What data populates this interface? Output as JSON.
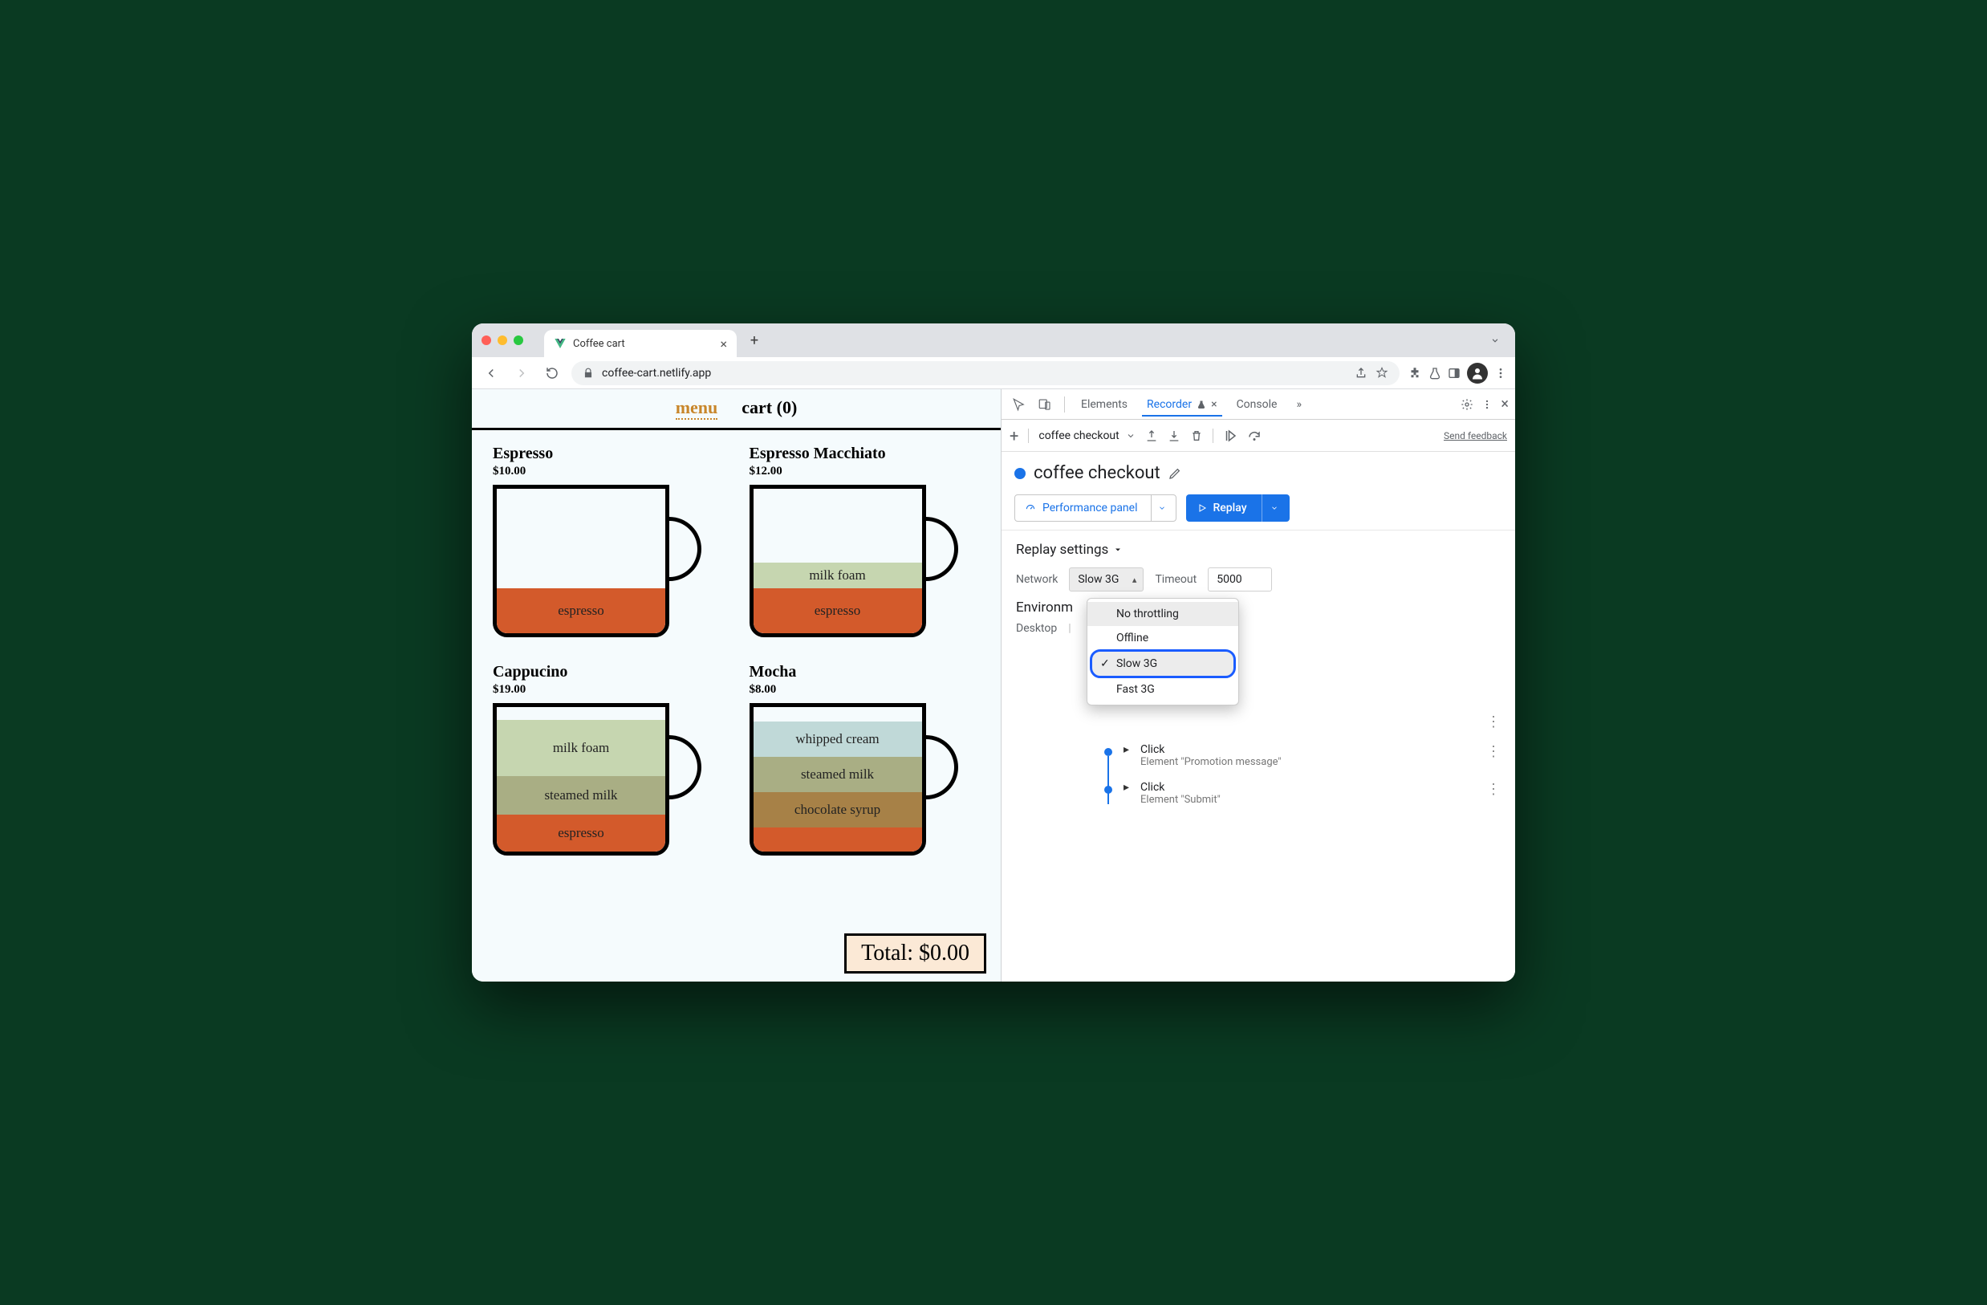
{
  "browser": {
    "tab_title": "Coffee cart",
    "url": "coffee-cart.netlify.app"
  },
  "page": {
    "nav": {
      "menu": "menu",
      "cart": "cart (0)"
    },
    "products": [
      {
        "name": "Espresso",
        "price": "$10.00",
        "layers": [
          "espresso"
        ]
      },
      {
        "name": "Espresso Macchiato",
        "price": "$12.00",
        "layers": [
          "milk foam",
          "espresso"
        ]
      },
      {
        "name": "Cappucino",
        "price": "$19.00",
        "layers": [
          "milk foam",
          "steamed milk",
          "espresso"
        ]
      },
      {
        "name": "Mocha",
        "price": "$8.00",
        "layers": [
          "whipped cream",
          "steamed milk",
          "chocolate syrup"
        ]
      }
    ],
    "total": "Total: $0.00"
  },
  "devtools": {
    "tabs": {
      "elements": "Elements",
      "recorder": "Recorder",
      "console": "Console",
      "more": "»"
    },
    "toolbar": {
      "recording_name": "coffee checkout",
      "send_feedback": "Send feedback"
    },
    "title": "coffee checkout",
    "actions": {
      "performance": "Performance panel",
      "replay": "Replay"
    },
    "replay_settings": {
      "heading": "Replay settings",
      "network_label": "Network",
      "network_value": "Slow 3G",
      "timeout_label": "Timeout",
      "timeout_value": "5000",
      "environment_label": "Environm",
      "desktop_label": "Desktop",
      "options": [
        "No throttling",
        "Offline",
        "Slow 3G",
        "Fast 3G"
      ]
    },
    "steps": [
      {
        "title": "Click",
        "sub": "Element \"Promotion message\""
      },
      {
        "title": "Click",
        "sub": "Element \"Submit\""
      }
    ]
  }
}
